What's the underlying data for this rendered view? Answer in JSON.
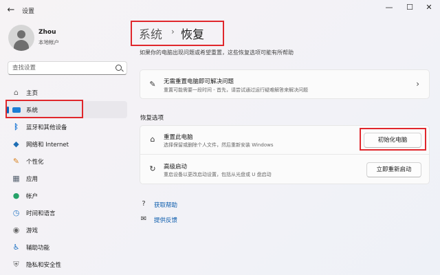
{
  "window": {
    "app_title": "设置",
    "back_glyph": "←",
    "min_glyph": "—",
    "max_glyph": "☐",
    "close_glyph": "✕"
  },
  "user": {
    "name": "Zhou",
    "account_type": "本地帐户"
  },
  "search": {
    "placeholder": "查找设置"
  },
  "sidebar": {
    "items": [
      {
        "label": "主页",
        "icon": "home-icon",
        "glyph": "⌂"
      },
      {
        "label": "系统",
        "icon": "system-icon",
        "glyph": "",
        "active": true
      },
      {
        "label": "蓝牙和其他设备",
        "icon": "bluetooth-icon",
        "glyph": "ᛒ"
      },
      {
        "label": "网络和 Internet",
        "icon": "network-icon",
        "glyph": "◆"
      },
      {
        "label": "个性化",
        "icon": "brush-icon",
        "glyph": "✎"
      },
      {
        "label": "应用",
        "icon": "apps-icon",
        "glyph": "▦"
      },
      {
        "label": "帐户",
        "icon": "account-icon",
        "glyph": "●"
      },
      {
        "label": "时间和语言",
        "icon": "globe-clock-icon",
        "glyph": "◷"
      },
      {
        "label": "游戏",
        "icon": "gamepad-icon",
        "glyph": "◉"
      },
      {
        "label": "辅助功能",
        "icon": "accessibility-icon",
        "glyph": "♿"
      },
      {
        "label": "隐私和安全性",
        "icon": "shield-icon",
        "glyph": "⛨"
      }
    ]
  },
  "breadcrumb": {
    "parent": "系统",
    "separator": "›",
    "current": "恢复"
  },
  "description": "如果你的电脑出现问题或希望重置，这些恢复选项可能有所帮助",
  "fix_card": {
    "title": "无需重置电脑即可解决问题",
    "subtitle": "重置可能需要一段时间 - 首先，请尝试通过运行疑难解答来解决问题",
    "icon_glyph": "✎",
    "chevron": "›"
  },
  "recovery_section": {
    "label": "恢复选项",
    "options": [
      {
        "title": "重置此电脑",
        "subtitle": "选择保留或删除个人文件，然后重新安装 Windows",
        "button": "初始化电脑",
        "icon_glyph": "⌂"
      },
      {
        "title": "高级启动",
        "subtitle": "重启设备以更改启动设置，包括从光盘或 U 盘启动",
        "button": "立即重新启动",
        "icon_glyph": "↻"
      }
    ]
  },
  "links": [
    {
      "label": "获取帮助",
      "icon_glyph": "?"
    },
    {
      "label": "提供反馈",
      "icon_glyph": "✉"
    }
  ],
  "colors": {
    "accent": "#0067c0",
    "highlight": "#e0262b",
    "link": "#0b5cad"
  }
}
